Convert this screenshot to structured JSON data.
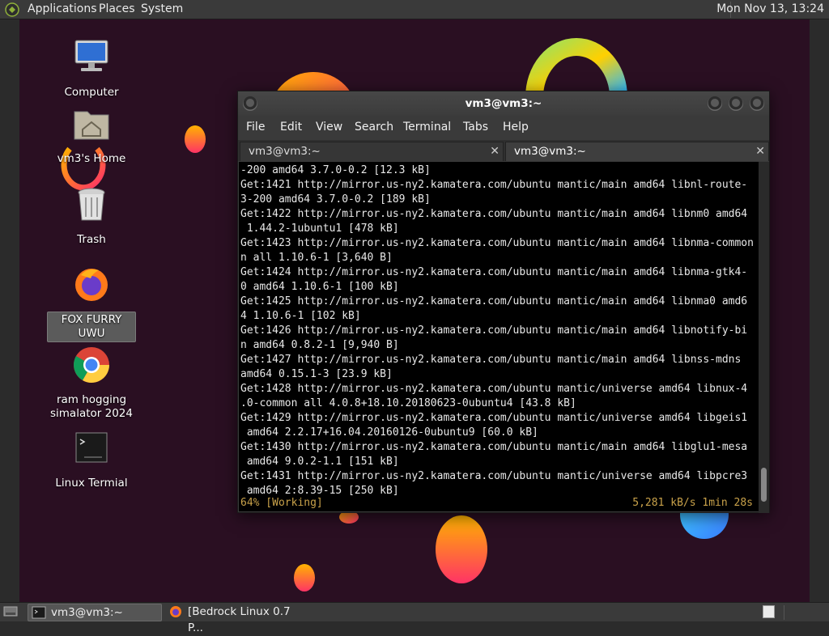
{
  "top_panel": {
    "menus": [
      "Applications",
      "Places",
      "System"
    ],
    "clock": "Mon Nov 13, 13:24"
  },
  "desktop": {
    "icons": [
      {
        "label": "Computer"
      },
      {
        "label": "vm3's Home"
      },
      {
        "label": "Trash"
      },
      {
        "label": "FOX FURRY UWU"
      },
      {
        "label": "ram hogging\nsimalator 2024"
      },
      {
        "label": "Linux Termial"
      }
    ]
  },
  "terminal": {
    "title": "vm3@vm3:~",
    "menu": [
      "File",
      "Edit",
      "View",
      "Search",
      "Terminal",
      "Tabs",
      "Help"
    ],
    "tabs": [
      {
        "label": "vm3@vm3:~"
      },
      {
        "label": "vm3@vm3:~"
      }
    ],
    "lines": [
      "-200 amd64 3.7.0-0.2 [12.3 kB]",
      "Get:1421 http://mirror.us-ny2.kamatera.com/ubuntu mantic/main amd64 libnl-route-",
      "3-200 amd64 3.7.0-0.2 [189 kB]",
      "Get:1422 http://mirror.us-ny2.kamatera.com/ubuntu mantic/main amd64 libnm0 amd64",
      " 1.44.2-1ubuntu1 [478 kB]",
      "Get:1423 http://mirror.us-ny2.kamatera.com/ubuntu mantic/main amd64 libnma-common",
      "n all 1.10.6-1 [3,640 B]",
      "Get:1424 http://mirror.us-ny2.kamatera.com/ubuntu mantic/main amd64 libnma-gtk4-",
      "0 amd64 1.10.6-1 [100 kB]",
      "Get:1425 http://mirror.us-ny2.kamatera.com/ubuntu mantic/main amd64 libnma0 amd6",
      "4 1.10.6-1 [102 kB]",
      "Get:1426 http://mirror.us-ny2.kamatera.com/ubuntu mantic/main amd64 libnotify-bi",
      "n amd64 0.8.2-1 [9,940 B]",
      "Get:1427 http://mirror.us-ny2.kamatera.com/ubuntu mantic/main amd64 libnss-mdns",
      "amd64 0.15.1-3 [23.9 kB]",
      "Get:1428 http://mirror.us-ny2.kamatera.com/ubuntu mantic/universe amd64 libnux-4",
      ".0-common all 4.0.8+18.10.20180623-0ubuntu4 [43.8 kB]",
      "Get:1429 http://mirror.us-ny2.kamatera.com/ubuntu mantic/universe amd64 libgeis1",
      " amd64 2.2.17+16.04.20160126-0ubuntu9 [60.0 kB]",
      "Get:1430 http://mirror.us-ny2.kamatera.com/ubuntu mantic/main amd64 libglu1-mesa",
      " amd64 9.0.2-1.1 [151 kB]",
      "Get:1431 http://mirror.us-ny2.kamatera.com/ubuntu mantic/universe amd64 libpcre3",
      " amd64 2:8.39-15 [250 kB]"
    ],
    "status_left": "64% [Working]",
    "status_right": "5,281 kB/s 1min 28s"
  },
  "taskbar": {
    "tasks": [
      {
        "label": "vm3@vm3:~"
      },
      {
        "label": "[Bedrock Linux 0.7 P..."
      }
    ]
  },
  "colors": {
    "desktop_bg": "#2a0f22",
    "status_text": "#c9a24a",
    "panel_bg": "#3a3a3a"
  }
}
